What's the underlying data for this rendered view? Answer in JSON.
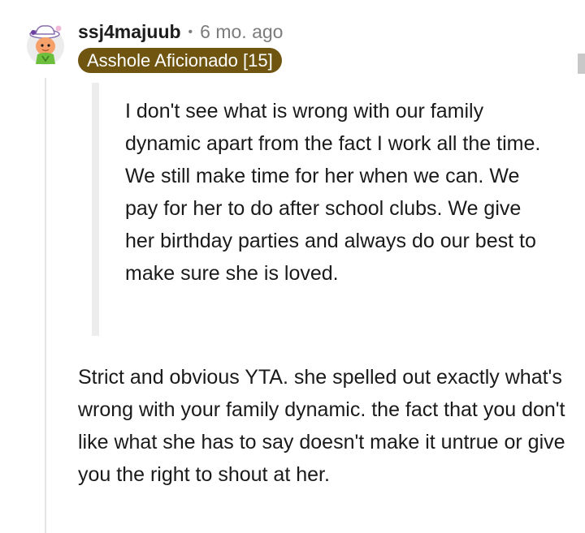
{
  "comment": {
    "author": "ssj4majuub",
    "separator": "•",
    "age": "6 mo. ago",
    "flair": "Asshole Aficionado [15]",
    "avatar_icon": "snoo-avatar-icon",
    "quote": "I don't see what is wrong with our family dynamic apart from the fact I work all the time. We still make time for her when we can. We pay for her to do after school clubs. We give her birthday parties and always do our best to make sure she is loved.",
    "body": "Strict and obvious YTA. she spelled out exactly what's wrong with your family dynamic. the fact that you don't like what she has to say doesn't make it untrue or give you the right to shout at her."
  },
  "colors": {
    "flair_bg": "#6f5510",
    "flair_text": "#ffffff",
    "meta_text": "#7c7c7c",
    "quote_bar": "#ededed",
    "thread_line": "#e4e4e4"
  }
}
